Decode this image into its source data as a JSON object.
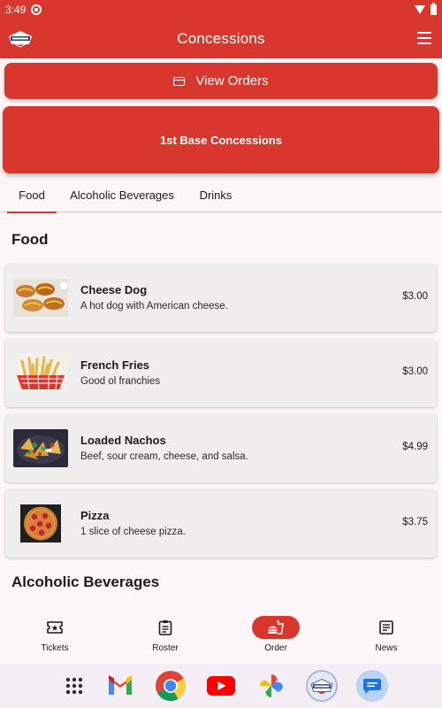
{
  "status_bar": {
    "time": "3:49"
  },
  "app_bar": {
    "title": "Concessions",
    "logo": "team-logo-icon",
    "menu_icon": "hamburger-menu-icon"
  },
  "view_orders": {
    "label": "View Orders",
    "icon": "credit-card-icon"
  },
  "stand": {
    "name": "1st Base Concessions"
  },
  "tabs": [
    {
      "label": "Food",
      "active": true
    },
    {
      "label": "Alcoholic Beverages",
      "active": false
    },
    {
      "label": "Drinks",
      "active": false
    }
  ],
  "sections": {
    "food": {
      "title": "Food",
      "items": [
        {
          "name": "Cheese Dog",
          "description": "A hot dog with American cheese.",
          "price": "$3.00"
        },
        {
          "name": "French Fries",
          "description": "Good ol franchies",
          "price": "$3.00"
        },
        {
          "name": "Loaded Nachos",
          "description": "Beef, sour cream, cheese, and salsa.",
          "price": "$4.99"
        },
        {
          "name": "Pizza",
          "description": "1 slice of cheese pizza.",
          "price": "$3.75"
        }
      ]
    },
    "alcoholic_beverages": {
      "title": "Alcoholic Beverages"
    }
  },
  "bottom_nav": [
    {
      "label": "Tickets",
      "icon": "ticket-icon",
      "active": false
    },
    {
      "label": "Roster",
      "icon": "clipboard-icon",
      "active": false
    },
    {
      "label": "Order",
      "icon": "fastfood-icon",
      "active": true
    },
    {
      "label": "News",
      "icon": "newspaper-icon",
      "active": false
    }
  ],
  "dock": [
    "app-drawer-icon",
    "gmail-icon",
    "chrome-icon",
    "youtube-icon",
    "photos-icon",
    "team-app-icon",
    "messages-icon"
  ],
  "colors": {
    "primary": "#d9372d",
    "background": "#fdf6f8",
    "card": "#efedee",
    "text": "#1c1b1f"
  }
}
